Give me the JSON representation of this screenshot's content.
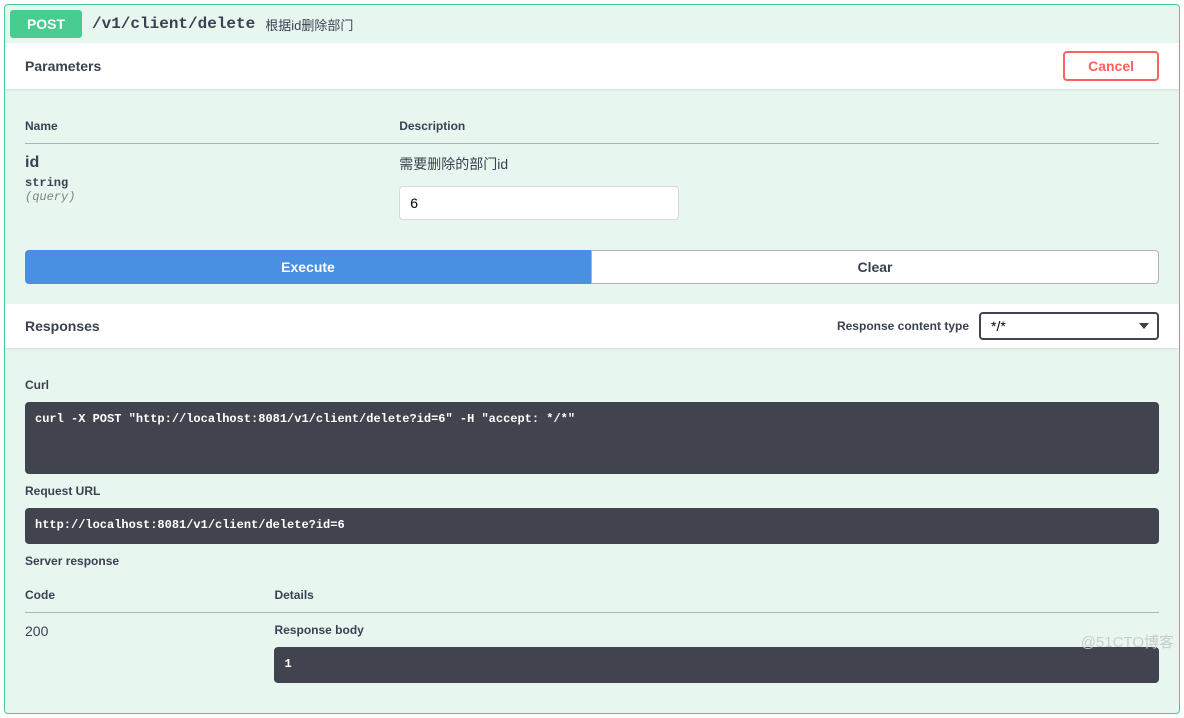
{
  "opblock": {
    "method": "POST",
    "path": "/v1/client/delete",
    "summary": "根据id删除部门"
  },
  "parameters": {
    "title": "Parameters",
    "cancel_label": "Cancel",
    "headers": {
      "name": "Name",
      "description": "Description"
    },
    "items": [
      {
        "name": "id",
        "type": "string",
        "in": "(query)",
        "description": "需要删除的部门id",
        "value": "6"
      }
    ]
  },
  "buttons": {
    "execute": "Execute",
    "clear": "Clear"
  },
  "responses": {
    "title": "Responses",
    "content_type_label": "Response content type",
    "content_type_value": "*/*",
    "curl_label": "Curl",
    "curl_value": "curl -X POST \"http://localhost:8081/v1/client/delete?id=6\" -H \"accept: */*\"",
    "request_url_label": "Request URL",
    "request_url_value": "http://localhost:8081/v1/client/delete?id=6",
    "server_response_label": "Server response",
    "table_headers": {
      "code": "Code",
      "details": "Details"
    },
    "code": "200",
    "response_body_label": "Response body",
    "response_body_value": "1"
  },
  "watermark": "@51CTO博客"
}
